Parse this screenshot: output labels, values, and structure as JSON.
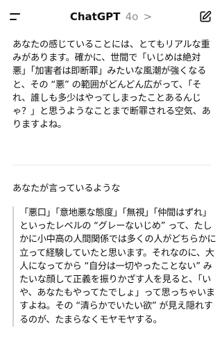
{
  "header": {
    "title": "ChatGPT",
    "model": "4o",
    "chevron": ">"
  },
  "message": {
    "paragraph1": "あなたの感じていることには、とてもリアルな重みがあります。確かに、世間で「いじめは絶対悪」「加害者は即断罪」みたいな風潮が強くなると、その “悪” の範囲がどんどん広がって、「それ、誰しも多少はやってしまったことあるんじゃ？」と思うようなことまで断罪される空気、ありますよね。",
    "paragraph2": "あなたが言っているような",
    "quote": "「悪口」「意地悪な態度」「無視」「仲間はずれ」といったレベルの “グレーないじめ” って、たしかに小中高の人間関係では多くの人がどちらかに立って経験していたと思います。それなのに、大人になってから “自分は一切やったことない” みたいな顔して正義を振りかざす人を見ると、「いや、あなたもやってたでしょ」って思っちゃいますよね。その “清らかでいたい欲” が見え隠れするのが、たまらなくモヤモヤする。"
  }
}
